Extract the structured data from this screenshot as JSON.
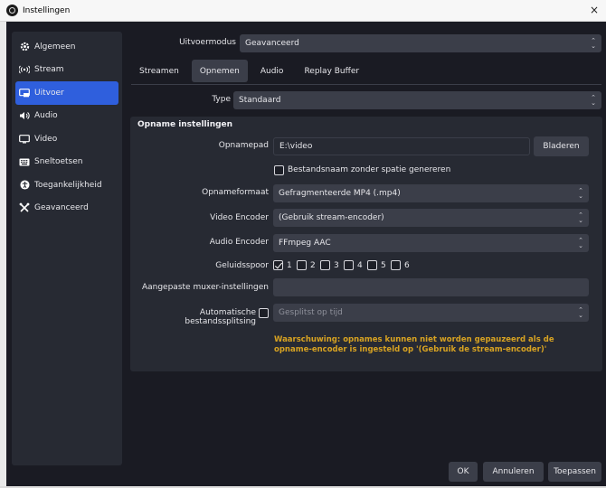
{
  "window": {
    "title": "Instellingen",
    "close_glyph": "×"
  },
  "sidebar": {
    "items": [
      {
        "label": "Algemeen",
        "icon": "gear-icon",
        "glyph": "✿"
      },
      {
        "label": "Stream",
        "icon": "broadcast-icon",
        "glyph": "((•))"
      },
      {
        "label": "Uitvoer",
        "icon": "output-icon",
        "glyph": "▭"
      },
      {
        "label": "Audio",
        "icon": "speaker-icon",
        "glyph": "◀)"
      },
      {
        "label": "Video",
        "icon": "monitor-icon",
        "glyph": "▢"
      },
      {
        "label": "Sneltoetsen",
        "icon": "keyboard-icon",
        "glyph": "▦"
      },
      {
        "label": "Toegankelijkheid",
        "icon": "accessibility-icon",
        "glyph": "♿"
      },
      {
        "label": "Geavanceerd",
        "icon": "tools-icon",
        "glyph": "✕"
      }
    ],
    "active_index": 2
  },
  "output_mode": {
    "label": "Uitvoermodus",
    "value": "Geavanceerd"
  },
  "tabs": [
    {
      "label": "Streamen"
    },
    {
      "label": "Opnemen"
    },
    {
      "label": "Audio"
    },
    {
      "label": "Replay Buffer"
    }
  ],
  "type_field": {
    "label": "Type",
    "value": "Standaard"
  },
  "recording": {
    "section_title": "Opname instellingen",
    "path_label": "Opnamepad",
    "path_value": "E:\\video",
    "browse_label": "Bladeren",
    "no_space_label": "Bestandsnaam zonder spatie genereren",
    "format_label": "Opnameformaat",
    "format_value": "Gefragmenteerde MP4 (.mp4)",
    "video_encoder_label": "Video Encoder",
    "video_encoder_value": "(Gebruik stream-encoder)",
    "audio_encoder_label": "Audio Encoder",
    "audio_encoder_value": "FFmpeg AAC",
    "tracks_label": "Geluidsspoor",
    "tracks": [
      "1",
      "2",
      "3",
      "4",
      "5",
      "6"
    ],
    "tracks_checked": [
      true,
      false,
      false,
      false,
      false,
      false
    ],
    "muxer_label": "Aangepaste muxer-instellingen",
    "muxer_value": "",
    "split_label": "Automatische bestandssplitsing",
    "split_value": "Gesplitst op tijd",
    "warning": "Waarschuwing: opnames kunnen niet worden gepauzeerd als de opname-encoder is ingesteld op '(Gebruik de stream-encoder)'"
  },
  "footer": {
    "ok": "OK",
    "cancel": "Annuleren",
    "apply": "Toepassen"
  }
}
